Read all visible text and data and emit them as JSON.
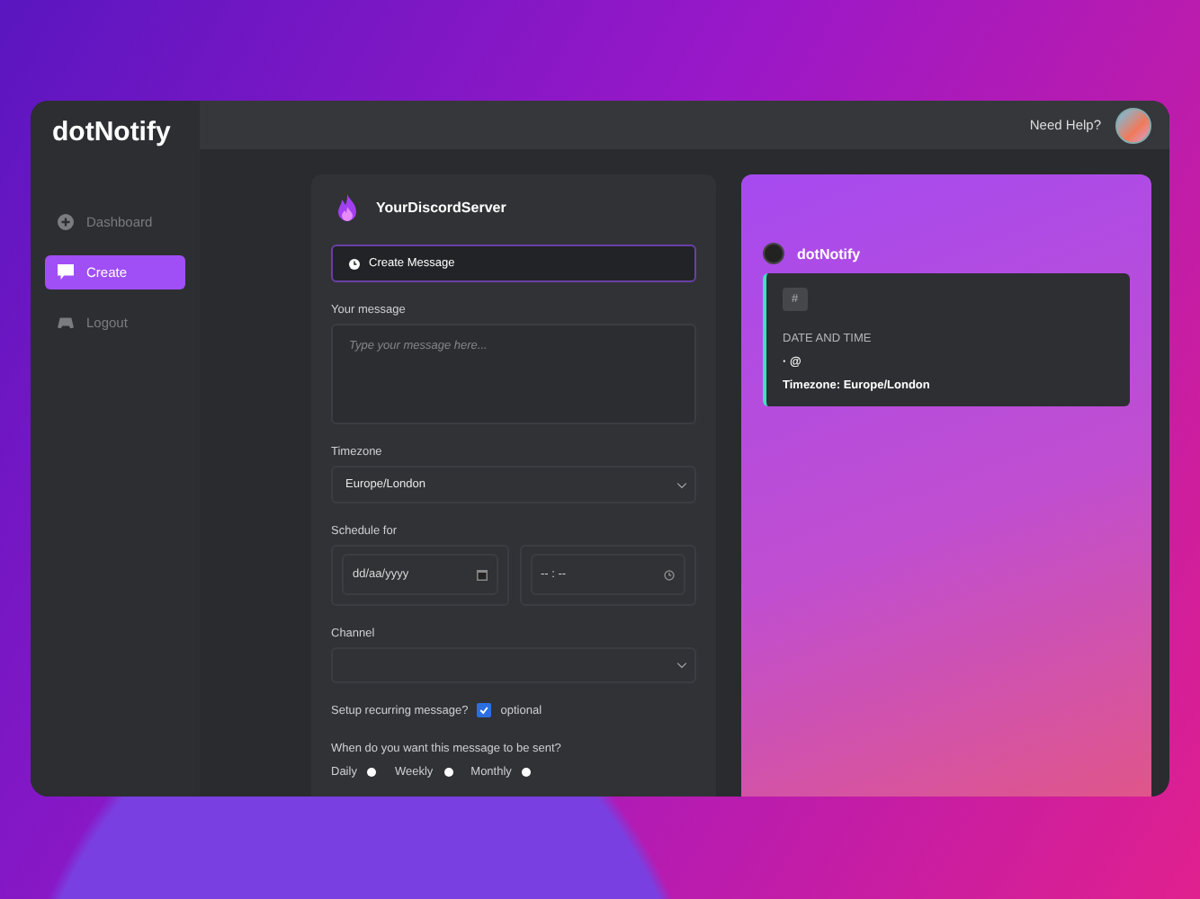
{
  "logo": "dotNotify",
  "topbar": {
    "help": "Need Help?"
  },
  "sidebar": {
    "items": [
      {
        "label": "Dashboard",
        "selected": false
      },
      {
        "label": "Create",
        "selected": true
      },
      {
        "label": "Logout",
        "selected": false
      }
    ]
  },
  "form": {
    "server": "YourDiscordServer",
    "create_button": "Create Message",
    "message": {
      "label": "Your message",
      "placeholder": "Type your message here..."
    },
    "timezone": {
      "label": "Timezone",
      "value": "Europe/London"
    },
    "schedule": {
      "label": "Schedule for",
      "date_placeholder": "dd/aa/yyyy",
      "time_placeholder": "-- : --"
    },
    "channel": {
      "label": "Channel"
    },
    "recurring": {
      "label": "Setup recurring message?",
      "checked": true,
      "note": "optional"
    },
    "frequency": {
      "question": "When do you want this message to be sent?",
      "options": [
        {
          "label": "Daily",
          "selected": false
        },
        {
          "label": "Weekly",
          "selected": false
        },
        {
          "label": "Monthly",
          "selected": false
        }
      ]
    }
  },
  "preview": {
    "bot_name": "dotNotify",
    "channel_tag": "#",
    "heading": "DATE AND TIME",
    "line": "· @",
    "timezone": "Timezone: Europe/London"
  }
}
